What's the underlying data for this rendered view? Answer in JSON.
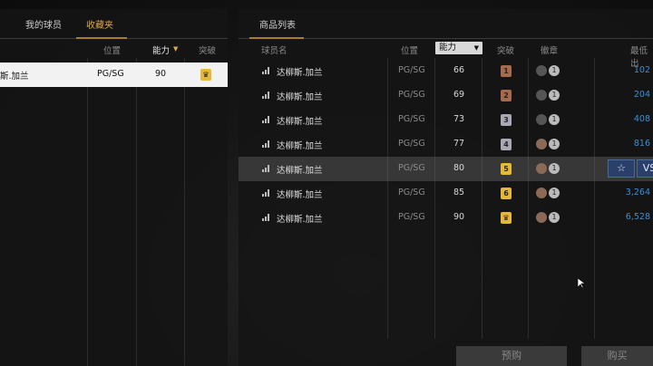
{
  "left_panel": {
    "tabs": [
      {
        "label": "我的球员",
        "active": false
      },
      {
        "label": "收藏夹",
        "active": true
      }
    ],
    "headers": {
      "position": "位置",
      "ability": "能力",
      "sort_arrow": "▼",
      "breakthrough": "突破"
    },
    "rows": [
      {
        "name": "斯.加兰",
        "position": "PG/SG",
        "ability": "90",
        "breakthrough": "♛",
        "selected": true
      }
    ]
  },
  "right_panel": {
    "tab": "商品列表",
    "headers": {
      "player": "球员名",
      "position": "位置",
      "ability": "能力",
      "sort_arrow": "▼",
      "breakthrough": "突破",
      "badge": "徽章",
      "min_price": "最低出"
    },
    "rows": [
      {
        "name": "达柳斯.加兰",
        "position": "PG/SG",
        "ability": "66",
        "breakthrough": "1",
        "price": "102"
      },
      {
        "name": "达柳斯.加兰",
        "position": "PG/SG",
        "ability": "69",
        "breakthrough": "2",
        "price": "204"
      },
      {
        "name": "达柳斯.加兰",
        "position": "PG/SG",
        "ability": "73",
        "breakthrough": "3",
        "price": "408"
      },
      {
        "name": "达柳斯.加兰",
        "position": "PG/SG",
        "ability": "77",
        "breakthrough": "4",
        "price": "816"
      },
      {
        "name": "达柳斯.加兰",
        "position": "PG/SG",
        "ability": "80",
        "breakthrough": "5",
        "price": ""
      },
      {
        "name": "达柳斯.加兰",
        "position": "PG/SG",
        "ability": "85",
        "breakthrough": "6",
        "price": "3,264"
      },
      {
        "name": "达柳斯.加兰",
        "position": "PG/SG",
        "ability": "90",
        "breakthrough": "♛",
        "price": "6,528"
      }
    ],
    "badge_medal_count": "1",
    "hover_actions": {
      "favorite": "☆",
      "sell": "VS"
    },
    "buttons": {
      "preorder": "预购",
      "buy": "购买"
    }
  },
  "colors": {
    "accent": "#e0a84a",
    "price": "#3a8fd8",
    "tier_bronze": "#a86a4e",
    "tier_silver": "#a9a9b4",
    "tier_gold": "#e6b83a"
  }
}
